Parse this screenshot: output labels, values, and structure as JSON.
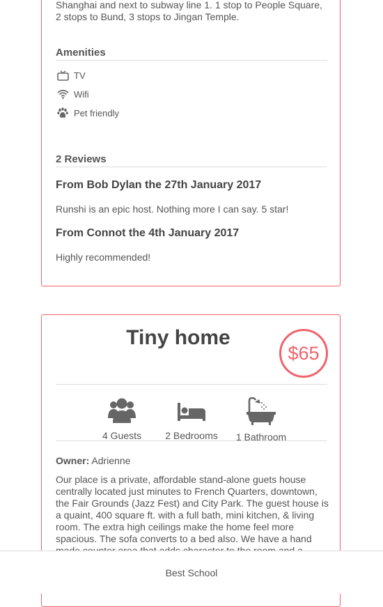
{
  "listing1": {
    "transport_text": "Shanghai and next to subway line 1. 1 stop to People Square, 2 stops to Bund, 3 stops to Jingan Temple.",
    "amenities_heading": "Amenities",
    "amenities": [
      {
        "icon": "tv-icon",
        "label": "TV"
      },
      {
        "icon": "wifi-icon",
        "label": "Wifi"
      },
      {
        "icon": "paw-icon",
        "label": "Pet friendly"
      }
    ],
    "reviews_heading": "2 Reviews",
    "reviews": [
      {
        "header": "From Bob Dylan the 27th January 2017",
        "text": "Runshi is an epic host. Nothing more I can say. 5 star!"
      },
      {
        "header": "From Connot the 4th January 2017",
        "text": "Highly recommended!"
      }
    ]
  },
  "listing2": {
    "title": "Tiny home",
    "price": "$65",
    "stats": [
      {
        "icon": "users-icon",
        "label": "4 Guests"
      },
      {
        "icon": "bed-icon",
        "label": "2 Bedrooms"
      },
      {
        "icon": "bath-icon",
        "label": "1 Bathroom"
      }
    ],
    "owner_label": "Owner:",
    "owner_name": "Adrienne",
    "description": "Our place is a private, affordable stand-alone guets house centrally located just minutes to French Quarters, downtown, the Fair Grounds (Jazz Fest) and City Park. The guest house is a quaint, 400 square ft. with a full bath, mini kitchen, & living room. The extra high ceilings make the home feel more spacious. The sofa converts to a bed also. We have a hand made counter area that adds character to the room and a"
  },
  "footer": {
    "text": "Best School"
  },
  "colors": {
    "accent": "#f0636b",
    "text": "#444444",
    "icon": "#666666"
  }
}
